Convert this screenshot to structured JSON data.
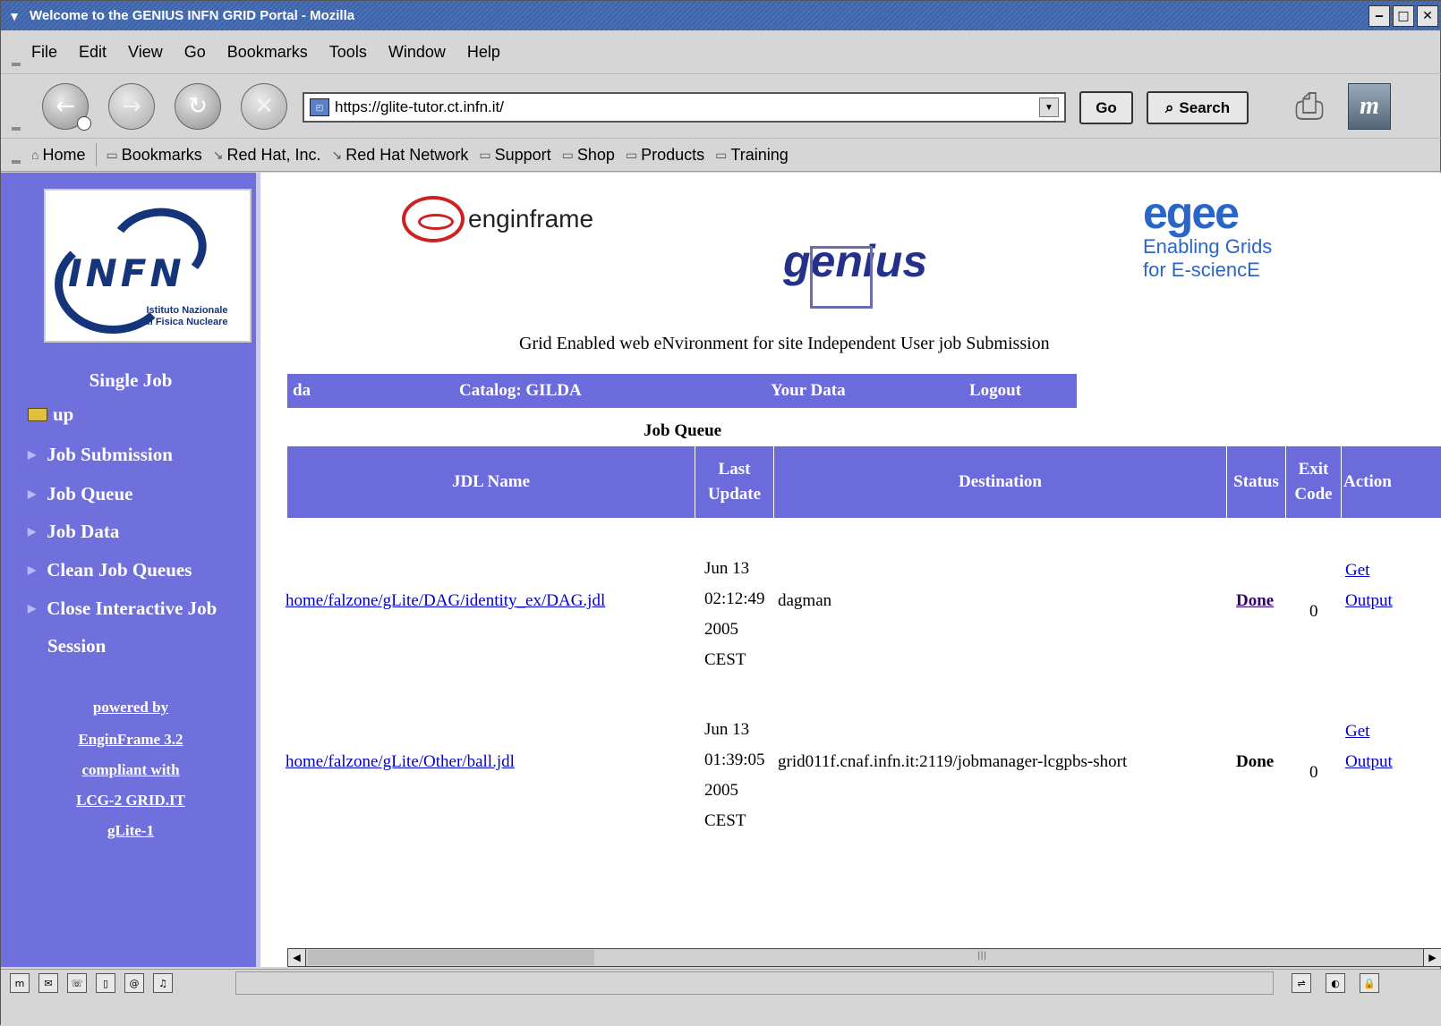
{
  "window": {
    "title": "Welcome to the GENIUS INFN GRID Portal - Mozilla",
    "minimize": "‒",
    "maximize": "□",
    "close": "✕"
  },
  "menu": {
    "file": "File",
    "edit": "Edit",
    "view": "View",
    "go": "Go",
    "bookmarks": "Bookmarks",
    "tools": "Tools",
    "window": "Window",
    "help": "Help"
  },
  "nav": {
    "url": "https://glite-tutor.ct.infn.it/",
    "go_label": "Go",
    "search_label": "Search"
  },
  "bookmarks": [
    "Home",
    "Bookmarks",
    "Red Hat, Inc.",
    "Red Hat Network",
    "Support",
    "Shop",
    "Products",
    "Training"
  ],
  "sidebar": {
    "logo_text": "INFN",
    "logo_sub1": "Istituto Nazionale",
    "logo_sub2": "di Fisica Nucleare",
    "title": "Single Job",
    "up": "up",
    "items": [
      "Job Submission",
      "Job Queue",
      "Job Data",
      "Clean Job Queues",
      "Close Interactive Job",
      "Session"
    ],
    "powered": [
      "powered by",
      "EnginFrame 3.2",
      "compliant with",
      "LCG-2 GRID.IT",
      "gLite-1"
    ]
  },
  "header": {
    "enginframe": "enginframe",
    "genius": "genius",
    "egee": "egee",
    "egee_line1": "Enabling Grids",
    "egee_line2": "for E-sciencE",
    "tagline": "Grid Enabled web eNvironment for site Independent User job Submission"
  },
  "menu_bar": {
    "data": "da",
    "catalog": "Catalog: GILDA",
    "your_data": "Your Data",
    "logout": "Logout"
  },
  "queue": {
    "title": "Job Queue",
    "columns": [
      "JDL Name",
      "Last Update",
      "Destination",
      "Status",
      "Exit Code",
      "Action"
    ],
    "rows": [
      {
        "jdl": "home/falzone/gLite/DAG/identity_ex/DAG.jdl",
        "date1": "Jun 13",
        "date2": "02:12:49",
        "date3": "2005",
        "date4": "CEST",
        "destination": "dagman",
        "status": "Done",
        "exit": "0",
        "action1": "Get",
        "action2": "Output"
      },
      {
        "jdl": "home/falzone/gLite/Other/ball.jdl",
        "date1": "Jun 13",
        "date2": "01:39:05",
        "date3": "2005",
        "date4": "CEST",
        "destination": "grid011f.cnaf.infn.it:2119/jobmanager-lcgpbs-short",
        "status": "Done",
        "exit": "0",
        "action1": "Get",
        "action2": "Output"
      }
    ]
  }
}
